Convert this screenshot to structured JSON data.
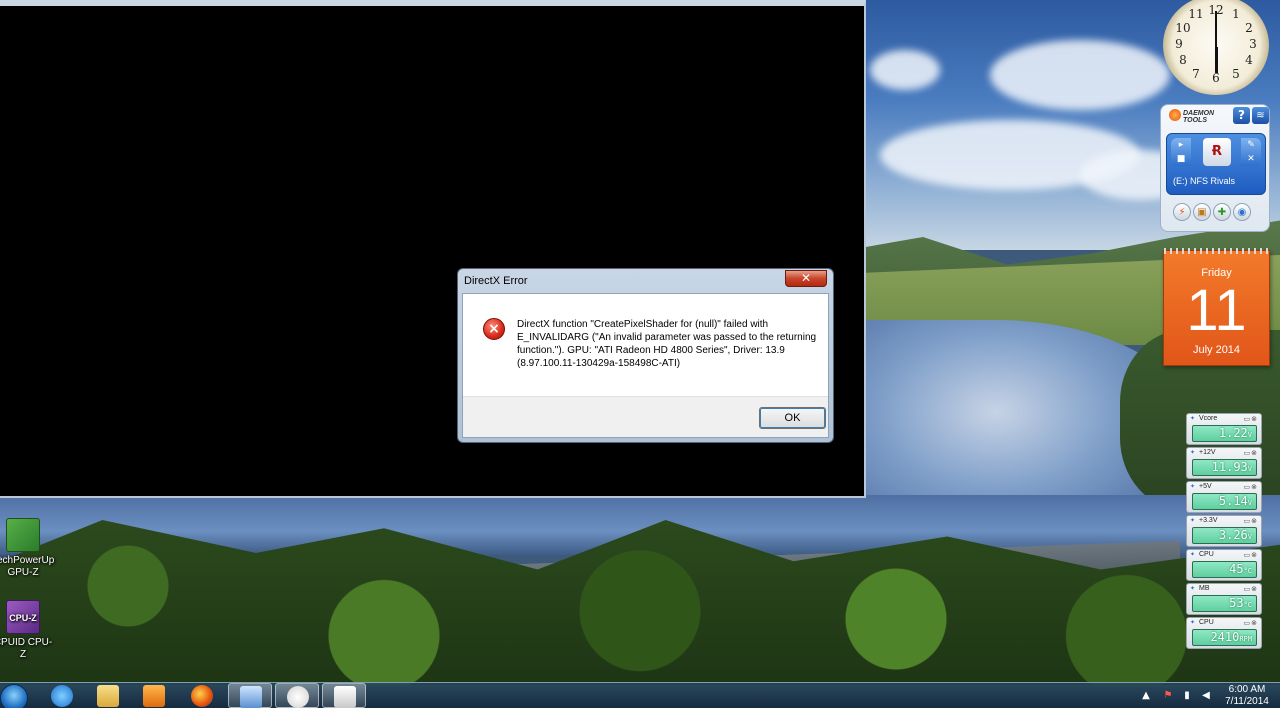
{
  "dialog": {
    "title": "DirectX Error",
    "close_glyph": "✕",
    "message": "DirectX function \"CreatePixelShader for (null)\" failed with E_INVALIDARG (\"An invalid parameter was passed to the returning function.\"). GPU: \"ATI Radeon HD 4800 Series\", Driver: 13.9 (8.97.100.11-130429a-158498C-ATI)",
    "ok_label": "OK",
    "icon": "error-icon"
  },
  "desktop_icons": [
    {
      "label_line1": "TechPowerUp",
      "label_line2": "GPU-Z",
      "icon": "gpuz-icon"
    },
    {
      "label_line1": "CPUID CPU-Z",
      "icon_text": "CPU-Z",
      "icon": "cpuz-icon"
    }
  ],
  "clock_gadget": {
    "numbers": [
      "12",
      "1",
      "2",
      "3",
      "4",
      "5",
      "6",
      "7",
      "8",
      "9",
      "10",
      "11"
    ]
  },
  "daemon_tools": {
    "brand_line1": "DAEMON",
    "brand_line2": "TOOLS",
    "help_glyph": "?",
    "rss_glyph": "≋",
    "drive_label": "(E:) NFS Rivals"
  },
  "calendar": {
    "day": "Friday",
    "date": "11",
    "month": "July 2014"
  },
  "sensors": [
    {
      "label": "Vcore",
      "value": "1.22",
      "unit": "V"
    },
    {
      "label": "+12V",
      "value": "11.93",
      "unit": "V"
    },
    {
      "label": "+5V",
      "value": "5.14",
      "unit": "V"
    },
    {
      "label": "+3.3V",
      "value": "3.26",
      "unit": "V"
    },
    {
      "label": "CPU",
      "value": "45",
      "unit": "°C"
    },
    {
      "label": "MB",
      "value": "53",
      "unit": "°C"
    },
    {
      "label": "CPU",
      "value": "2410",
      "unit": "RPM"
    }
  ],
  "taskbar": {
    "time": "6:00 AM",
    "date": "7/11/2014",
    "apps": [
      "internet-explorer",
      "windows-explorer",
      "media-player",
      "firefox",
      "control-panel",
      "app",
      "nfs-rivals"
    ]
  },
  "colors": {
    "dialog_close": "#c7452b",
    "calendar": "#e1561a",
    "lcd": "#5fcf9f"
  }
}
